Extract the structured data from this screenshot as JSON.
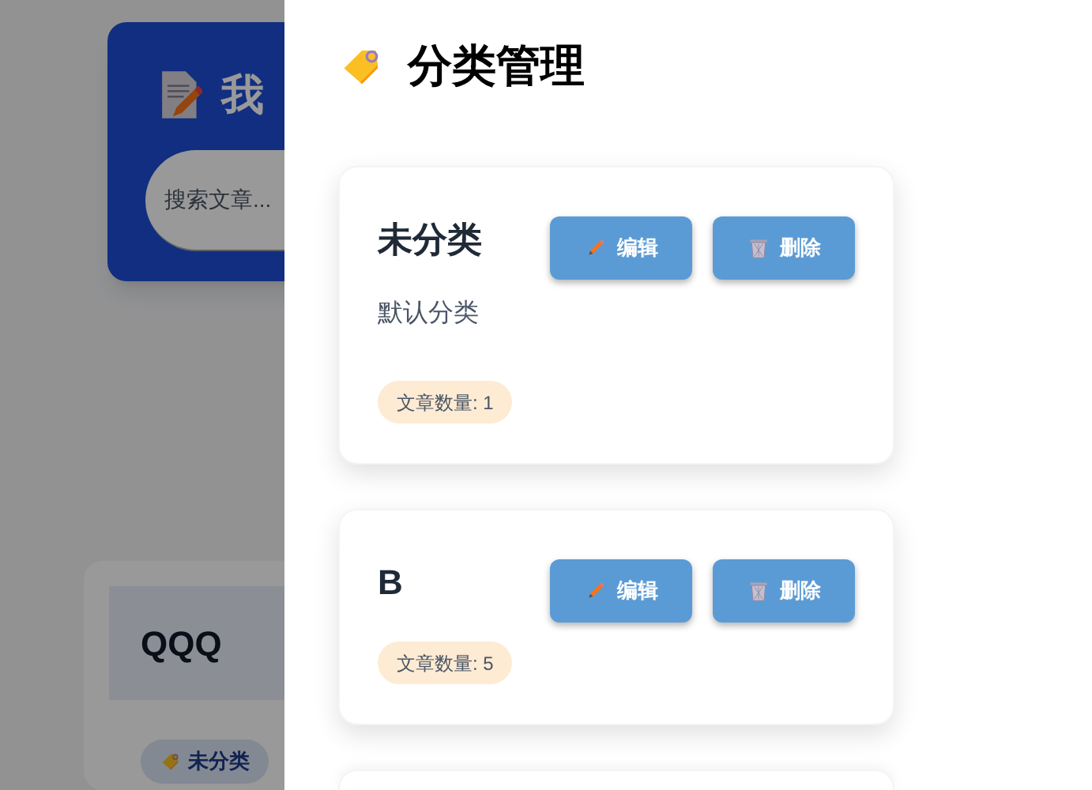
{
  "background_page": {
    "header": {
      "title": "我",
      "search": {
        "placeholder": "搜索文章..."
      }
    },
    "article_card": {
      "title": "QQQ",
      "category_tag": "未分类"
    }
  },
  "category_panel": {
    "title": "分类管理",
    "categories": [
      {
        "name": "未分类",
        "description": "默认分类",
        "count": "文章数量: 1",
        "edit_button": "编辑",
        "delete_button": "删除"
      },
      {
        "name": "B",
        "count": "文章数量: 5",
        "edit_button": "编辑",
        "delete_button": "删除"
      }
    ],
    "more_cards_below": true
  }
}
